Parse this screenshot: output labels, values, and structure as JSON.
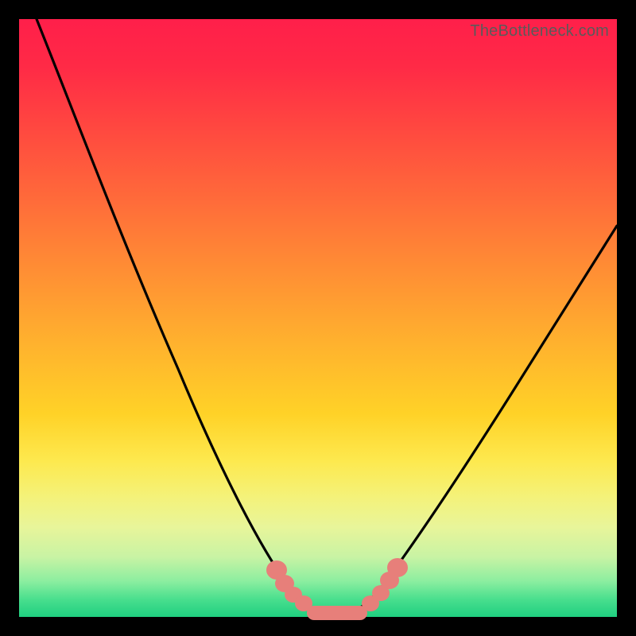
{
  "watermark": "TheBottleneck.com",
  "chart_data": {
    "type": "line",
    "title": "",
    "xlabel": "",
    "ylabel": "",
    "xlim": [
      0,
      100
    ],
    "ylim": [
      0,
      100
    ],
    "grid": false,
    "background_gradient": [
      "#ff1f4a",
      "#ff6a3a",
      "#ffd227",
      "#f4f27a",
      "#1fcf80"
    ],
    "series": [
      {
        "name": "bottleneck-curve",
        "color": "#000000",
        "x": [
          3,
          8,
          14,
          20,
          26,
          32,
          36,
          40,
          43,
          46,
          49,
          51,
          53,
          56,
          58,
          61,
          65,
          70,
          76,
          82,
          88,
          94,
          100
        ],
        "y": [
          100,
          86,
          70,
          55,
          41,
          28,
          20,
          12,
          7,
          3,
          1,
          0,
          0,
          1,
          3,
          6,
          11,
          18,
          26,
          34,
          43,
          51,
          60
        ]
      },
      {
        "name": "valley-highlight",
        "color": "#e77f7a",
        "type": "scatter",
        "x": [
          42,
          43.5,
          45,
          47,
          49,
          51,
          53,
          55,
          57,
          58.5,
          60,
          61.5
        ],
        "y": [
          8,
          6,
          4,
          2,
          1,
          0,
          0,
          1,
          2,
          4,
          6,
          8
        ]
      }
    ]
  }
}
